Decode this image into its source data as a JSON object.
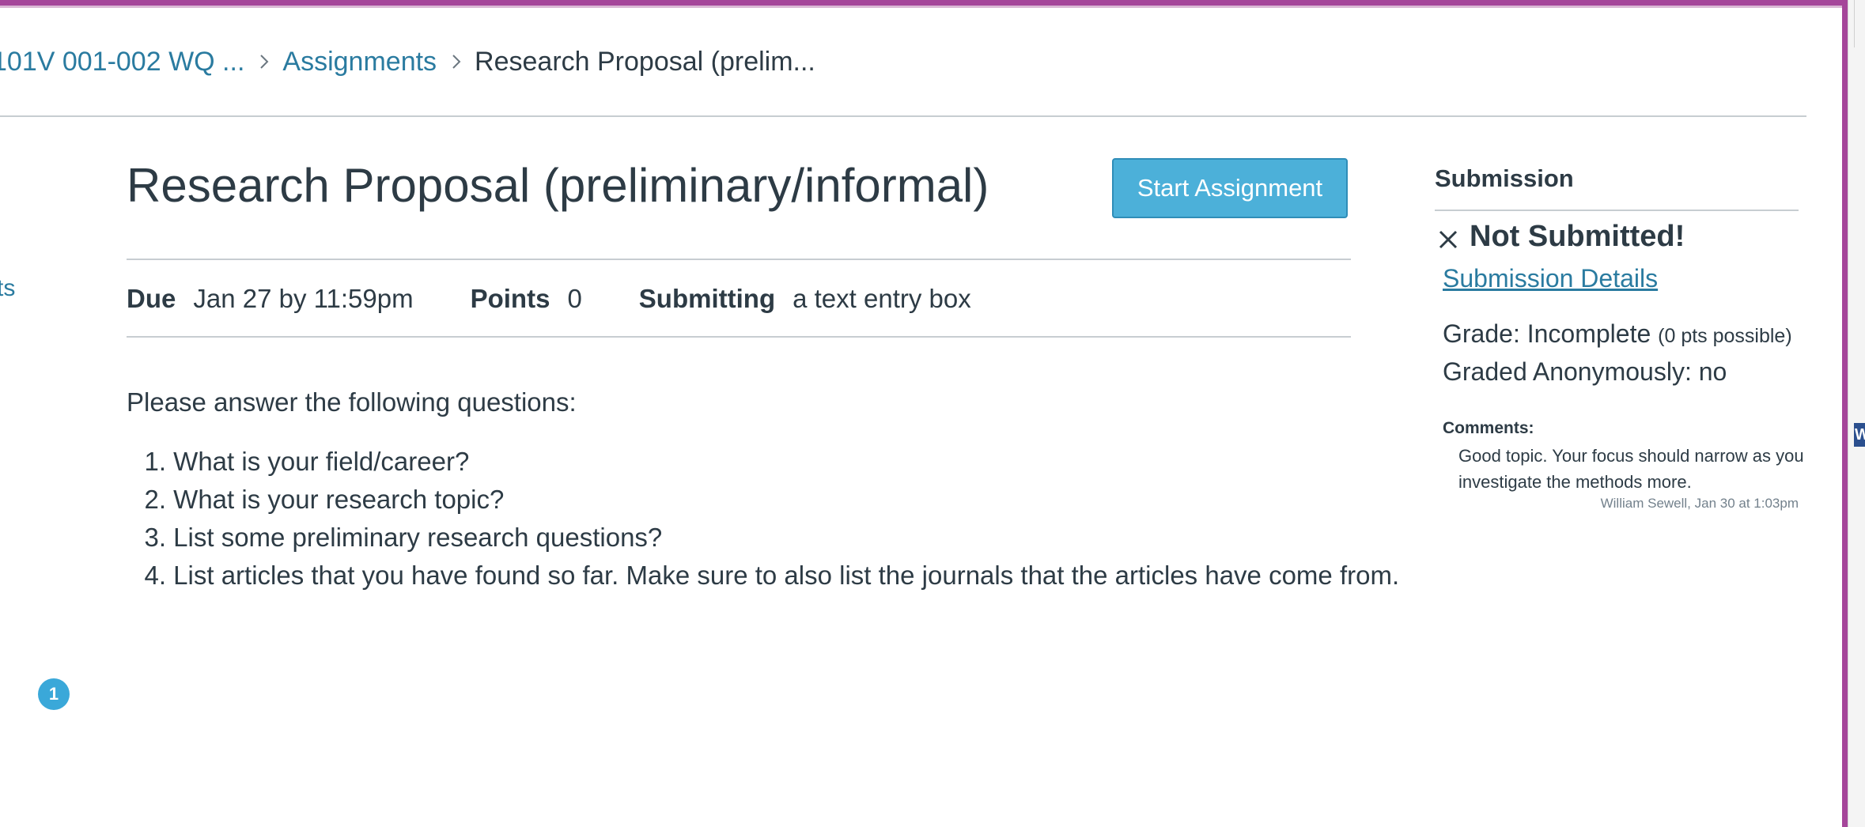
{
  "breadcrumb": {
    "course": "101V 001-002 WQ ...",
    "assignments": "Assignments",
    "current": "Research Proposal (prelim..."
  },
  "left_nav": {
    "stub_text": "ts",
    "badge_count": "1"
  },
  "gutter": {
    "tab_letter": "W"
  },
  "assignment": {
    "title": "Research Proposal (preliminary/informal)",
    "start_button": "Start Assignment",
    "due_label": "Due",
    "due_value": "Jan 27 by 11:59pm",
    "points_label": "Points",
    "points_value": "0",
    "submitting_label": "Submitting",
    "submitting_value": "a text entry box",
    "intro": "Please answer the following questions:",
    "questions": [
      {
        "num": "1.",
        "text": "What is your field/career?"
      },
      {
        "num": "2.",
        "text": "What is your research topic?"
      },
      {
        "num": "3.",
        "text": "List some preliminary research questions?"
      },
      {
        "num": "4.",
        "text": "List articles that you have found so far. Make sure to also list the journals that the articles have come from."
      }
    ]
  },
  "submission": {
    "heading": "Submission",
    "status": "Not Submitted!",
    "details_link": "Submission Details",
    "grade_label": "Grade: Incomplete",
    "grade_possible": "(0 pts possible)",
    "anonymous": "Graded Anonymously: no",
    "comments_label": "Comments:",
    "comment_text": "Good topic. Your focus should narrow as you investigate the methods more.",
    "comment_meta": "William Sewell, Jan 30 at 1:03pm"
  },
  "colors": {
    "accent_border": "#a5469a",
    "link": "#2a7ba0",
    "button": "#4cb0d9",
    "text": "#2d3b45"
  }
}
